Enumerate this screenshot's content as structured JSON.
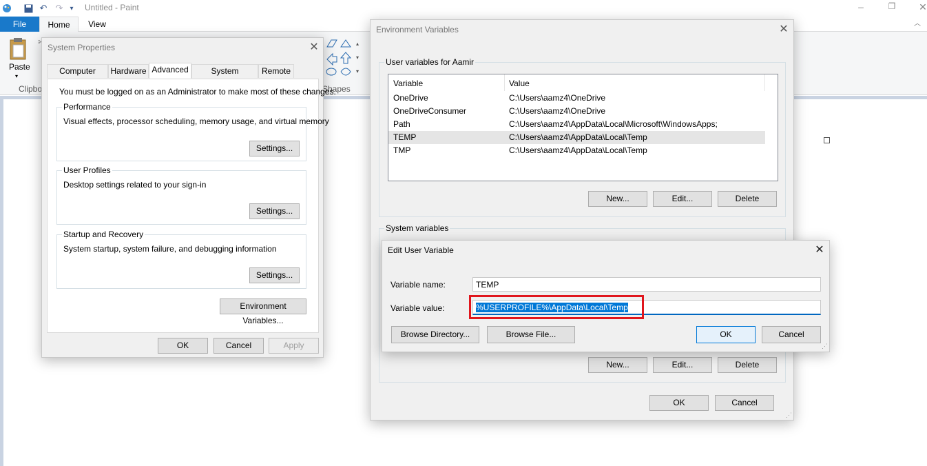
{
  "paint": {
    "title": "Untitled - Paint",
    "tabs": {
      "file": "File",
      "home": "Home",
      "view": "View"
    },
    "ribbon": {
      "paste": "Paste",
      "clipboard": "Clipbo",
      "shapes": "Shapes"
    }
  },
  "system_properties": {
    "title": "System Properties",
    "tabs": [
      "Computer Name",
      "Hardware",
      "Advanced",
      "System Protection",
      "Remote"
    ],
    "admin_note": "You must be logged on as an Administrator to make most of these changes.",
    "performance": {
      "label": "Performance",
      "desc": "Visual effects, processor scheduling, memory usage, and virtual memory",
      "button": "Settings..."
    },
    "user_profiles": {
      "label": "User Profiles",
      "desc": "Desktop settings related to your sign-in",
      "button": "Settings..."
    },
    "startup": {
      "label": "Startup and Recovery",
      "desc": "System startup, system failure, and debugging information",
      "button": "Settings..."
    },
    "env_button": "Environment Variables...",
    "ok": "OK",
    "cancel": "Cancel",
    "apply": "Apply"
  },
  "env_vars": {
    "title": "Environment Variables",
    "user_group": "User variables for Aamir",
    "columns": [
      "Variable",
      "Value"
    ],
    "rows": [
      {
        "name": "OneDrive",
        "value": "C:\\Users\\aamz4\\OneDrive"
      },
      {
        "name": "OneDriveConsumer",
        "value": "C:\\Users\\aamz4\\OneDrive"
      },
      {
        "name": "Path",
        "value": "C:\\Users\\aamz4\\AppData\\Local\\Microsoft\\WindowsApps;"
      },
      {
        "name": "TEMP",
        "value": "C:\\Users\\aamz4\\AppData\\Local\\Temp"
      },
      {
        "name": "TMP",
        "value": "C:\\Users\\aamz4\\AppData\\Local\\Temp"
      }
    ],
    "selected_row": "TEMP",
    "user_buttons": {
      "new": "New...",
      "edit": "Edit...",
      "delete": "Delete"
    },
    "system_group": "System variables",
    "system_buttons": {
      "new": "New...",
      "edit": "Edit...",
      "delete": "Delete"
    },
    "ok": "OK",
    "cancel": "Cancel"
  },
  "edit_var": {
    "title": "Edit User Variable",
    "name_label": "Variable name:",
    "name_value": "TEMP",
    "value_label": "Variable value:",
    "value_value": "%USERPROFILE%\\AppData\\Local\\Temp",
    "browse_dir": "Browse Directory...",
    "browse_file": "Browse File...",
    "ok": "OK",
    "cancel": "Cancel"
  },
  "colors": {
    "accent": "#0078d7",
    "highlight": "#e0161d",
    "file_tab": "#1979ca"
  }
}
